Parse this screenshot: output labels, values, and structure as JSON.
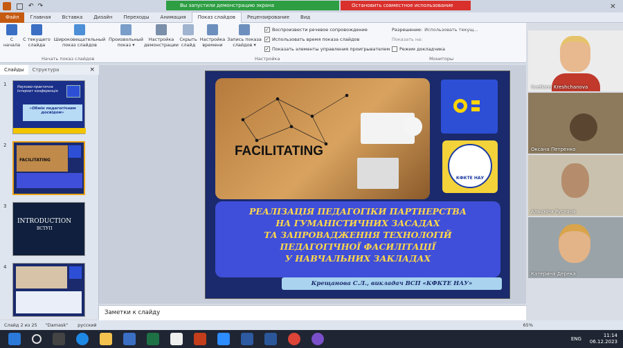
{
  "titlebar": {
    "demo_label": "Вы запустили демонстрацию экрана",
    "stop_label": "Остановить совместное использование",
    "win_controls": [
      "×"
    ]
  },
  "tabs": [
    "Файл",
    "Главная",
    "Вставка",
    "Дизайн",
    "Переходы",
    "Анимация",
    "Показ слайдов",
    "Рецензирование",
    "Вид"
  ],
  "ribbon": {
    "buttons": [
      {
        "label": "С\nначала"
      },
      {
        "label": "С текущего\nслайда"
      },
      {
        "label": "Широковещательный\nпоказ слайдов"
      },
      {
        "label": "Произвольный\nпоказ ▾"
      },
      {
        "label": "Настройка\nдемонстрации"
      },
      {
        "label": "Скрыть\nслайд"
      },
      {
        "label": "Настройка\nвремени"
      },
      {
        "label": "Запись показа\nслайдов ▾"
      }
    ],
    "checks": [
      {
        "label": "Воспроизвести речевое сопровождение",
        "checked": true
      },
      {
        "label": "Использовать время показа слайдов",
        "checked": true
      },
      {
        "label": "Показать элементы управления проигрывателем",
        "checked": true
      }
    ],
    "resolution_label": "Разрешение:",
    "resolution_value": "Использовать текущ...",
    "show_on_label": "Показать на:",
    "presenter_label": "Режим докладчика",
    "groups": [
      "Начать показ слайдов",
      "Настройка",
      "Мониторы"
    ]
  },
  "panel": {
    "tab_slides": "Слайды",
    "tab_outline": "Структура",
    "close": "×",
    "slides": [
      {
        "num": "1",
        "title": "Науково-практична Інтернет конференція",
        "sub": "«Обмін педагогічним досвідом»"
      },
      {
        "num": "2",
        "title": "FACILITATING"
      },
      {
        "num": "3",
        "title": "INTRODUCTION",
        "sub": "ВСТУП"
      },
      {
        "num": "4",
        "title": ""
      }
    ]
  },
  "slide": {
    "facilitating": "FACILITATING",
    "title_lines": [
      "РЕАЛІЗАЦІЯ ПЕДАГОГІКИ ПАРТНЕРСТВА",
      "НА ГУМАНІСТИЧНИХ ЗАСАДАХ",
      "ТА ЗАПРОВАДЖЕННЯ ТЕХНОЛОГІЙ",
      "ПЕДАГОГІЧНОЇ ФАСИЛІТАЦІЇ",
      "У НАВЧАЛЬНИХ ЗАКЛАДАХ"
    ],
    "author": "Крещанова С.Л., викладач ВСП «КФКТЕ НАУ»",
    "logo_text": "КФКТЕ НАУ"
  },
  "notes_placeholder": "Заметки к слайду",
  "status": {
    "slide_count": "Слайд 2 из 25",
    "theme": "\"Damask\"",
    "lang": "русский",
    "zoom": "65%"
  },
  "participants": [
    {
      "name": "Svetlana Kreshchanova"
    },
    {
      "name": "Оксана Петренко"
    },
    {
      "name": "Альохіна Руслана"
    },
    {
      "name": "Катерина Дерека"
    }
  ],
  "tray": {
    "lang": "ENG",
    "time": "11:14",
    "date": "06.12.2023"
  },
  "colors": {
    "accent_orange": "#c55a11",
    "demo_green": "#2e9e43",
    "stop_red": "#d9302c",
    "slide_blue": "#3f4fd9"
  }
}
